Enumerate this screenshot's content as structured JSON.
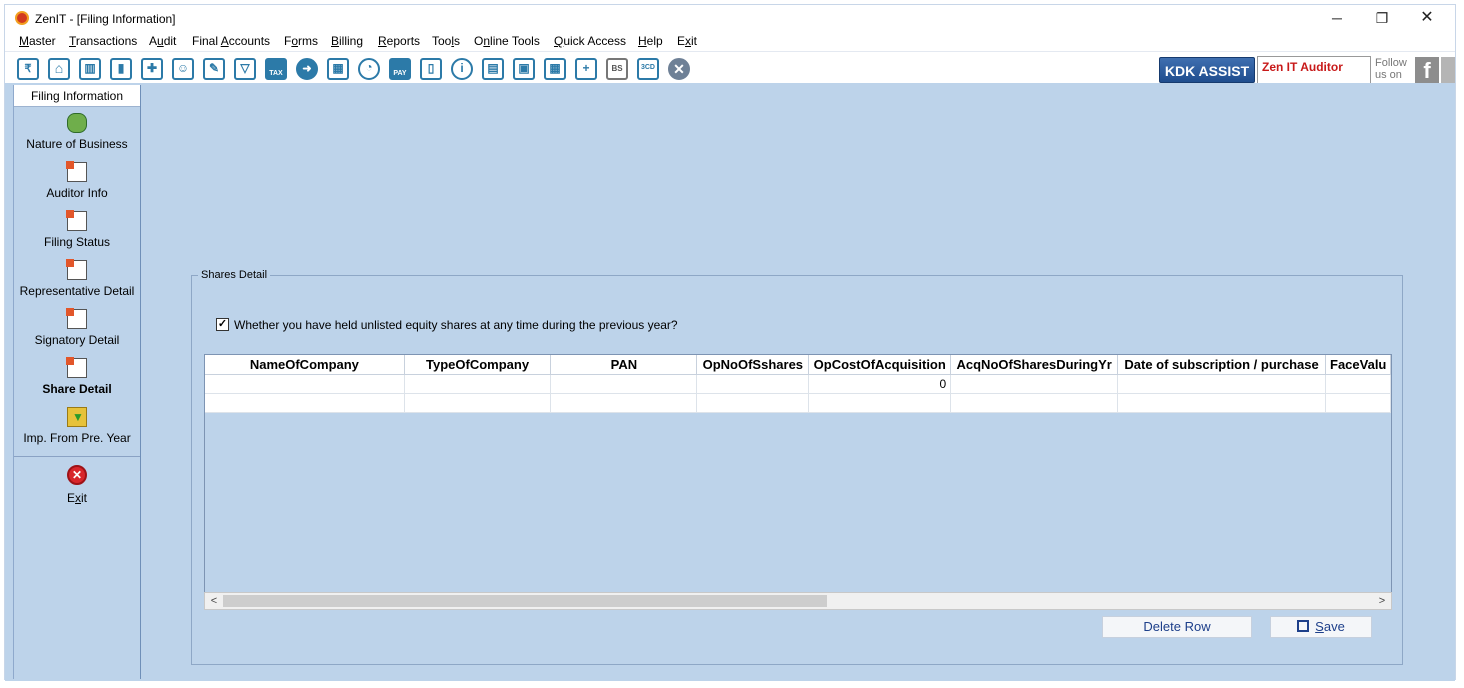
{
  "window": {
    "title": "ZenIT - [Filing Information]",
    "controls": {
      "minimize": "─",
      "restore": "❐",
      "close": "✕"
    }
  },
  "menubar": {
    "items": [
      {
        "pre": "",
        "u": "M",
        "post": "aster"
      },
      {
        "pre": "",
        "u": "T",
        "post": "ransactions"
      },
      {
        "pre": "A",
        "u": "u",
        "post": "dit"
      },
      {
        "pre": "Final ",
        "u": "A",
        "post": "ccounts"
      },
      {
        "pre": "F",
        "u": "o",
        "post": "rms"
      },
      {
        "pre": "",
        "u": "B",
        "post": "illing"
      },
      {
        "pre": "",
        "u": "R",
        "post": "eports"
      },
      {
        "pre": "Too",
        "u": "l",
        "post": "s"
      },
      {
        "pre": "O",
        "u": "n",
        "post": "line Tools"
      },
      {
        "pre": "",
        "u": "Q",
        "post": "uick Access"
      },
      {
        "pre": "",
        "u": "H",
        "post": "elp"
      },
      {
        "pre": "E",
        "u": "x",
        "post": "it"
      }
    ]
  },
  "toolbar": {
    "icons": [
      {
        "name": "rupee-icon",
        "glyph": "₹"
      },
      {
        "name": "home-icon",
        "glyph": "⌂"
      },
      {
        "name": "building-icon",
        "glyph": "▥"
      },
      {
        "name": "bar-chart-icon",
        "glyph": "▮"
      },
      {
        "name": "gift-icon",
        "glyph": "✚"
      },
      {
        "name": "users-icon",
        "glyph": "☺"
      },
      {
        "name": "pin-icon",
        "glyph": "✎"
      },
      {
        "name": "filter-icon",
        "glyph": "▽"
      },
      {
        "name": "tax-icon",
        "glyph": "TAX"
      },
      {
        "name": "arrow-circle-icon",
        "glyph": "➜"
      },
      {
        "name": "calculator-icon",
        "glyph": "▦"
      },
      {
        "name": "pie-chart-icon",
        "glyph": "◔"
      },
      {
        "name": "pay-icon",
        "glyph": "PAY"
      },
      {
        "name": "book-icon",
        "glyph": "▯"
      },
      {
        "name": "info-icon",
        "glyph": "i"
      },
      {
        "name": "report-icon",
        "glyph": "▤"
      },
      {
        "name": "user-doc-icon",
        "glyph": "▣"
      },
      {
        "name": "calendar-icon",
        "glyph": "▦"
      },
      {
        "name": "folder-add-icon",
        "glyph": "+"
      },
      {
        "name": "bs-icon",
        "glyph": "BS"
      },
      {
        "name": "3cd-icon",
        "glyph": "3CD"
      },
      {
        "name": "close-circle-icon",
        "glyph": "✕"
      }
    ],
    "kdk_assist": "KDK ASSIST",
    "zen_auditor": "Zen IT Auditor",
    "follow_line1": "Follow",
    "follow_line2": "us on",
    "facebook_glyph": "f"
  },
  "sidebar": {
    "header": "Filing Information",
    "items": [
      {
        "label": "Nature of Business",
        "icon": "money-icon"
      },
      {
        "label": "Auditor Info",
        "icon": "document-icon"
      },
      {
        "label": "Filing Status",
        "icon": "document-icon"
      },
      {
        "label": "Representative Detail",
        "icon": "document-icon"
      },
      {
        "label": "Signatory Detail",
        "icon": "document-icon"
      },
      {
        "label": "Share Detail",
        "icon": "document-icon",
        "active": true
      },
      {
        "label": "Imp. From Pre. Year",
        "icon": "import-icon"
      }
    ],
    "exit": {
      "pre": "E",
      "u": "x",
      "post": "it",
      "glyph": "✕"
    }
  },
  "shares_detail": {
    "group_title": "Shares Detail",
    "checkbox_label": "Whether you have held unlisted equity shares at any time during the previous year?",
    "checked": true,
    "check_glyph": "✓",
    "columns": [
      "NameOfCompany",
      "TypeOfCompany",
      "PAN",
      "OpNoOfSshares",
      "OpCostOfAcquisition",
      "AcqNoOfSharesDuringYr",
      "Date of subscription / purchase",
      "FaceValu"
    ],
    "rows": [
      [
        "",
        "",
        "",
        "",
        "0",
        "",
        "",
        ""
      ],
      [
        "",
        "",
        "",
        "",
        "",
        "",
        "",
        ""
      ]
    ],
    "scroll_left": "<",
    "scroll_right": ">",
    "delete_button": "Delete Row",
    "save_button": {
      "pre": "",
      "u": "S",
      "post": "ave"
    }
  }
}
